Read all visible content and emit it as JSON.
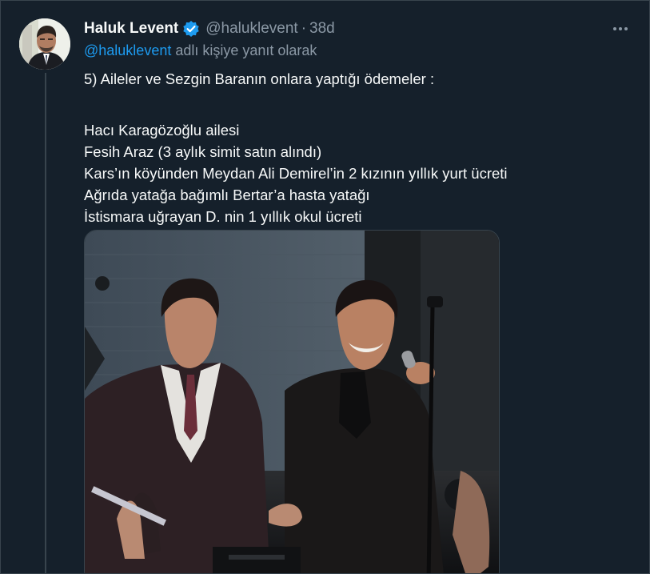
{
  "tweet": {
    "display_name": "Haluk Levent",
    "handle": "@haluklevent",
    "separator": "·",
    "age": "38d",
    "reply_to_handle": "@haluklevent",
    "reply_suffix": "adlı kişiye yanıt olarak",
    "lines": [
      "5) Aileler ve Sezgin Baranın onlara yaptığı ödemeler :",
      "Hacı Karagözoğlu ailesi",
      "Fesih Araz (3 aylık simit satın alındı)",
      "Kars’ın köyünden Meydan Ali Demirel’in 2 kızının yıllık yurt ücreti",
      "Ağrıda yatağa bağımlı Bertar’a hasta yatağı",
      "İstismara uğrayan D. nin 1 yıllık okul ücreti"
    ]
  },
  "icons": {
    "verified": "verified-badge-icon",
    "more": "more-options-icon"
  },
  "colors": {
    "background": "#15202b",
    "text": "#f7f9f9",
    "secondary": "#8b98a5",
    "link": "#1d9bf0",
    "border": "#38444d"
  }
}
